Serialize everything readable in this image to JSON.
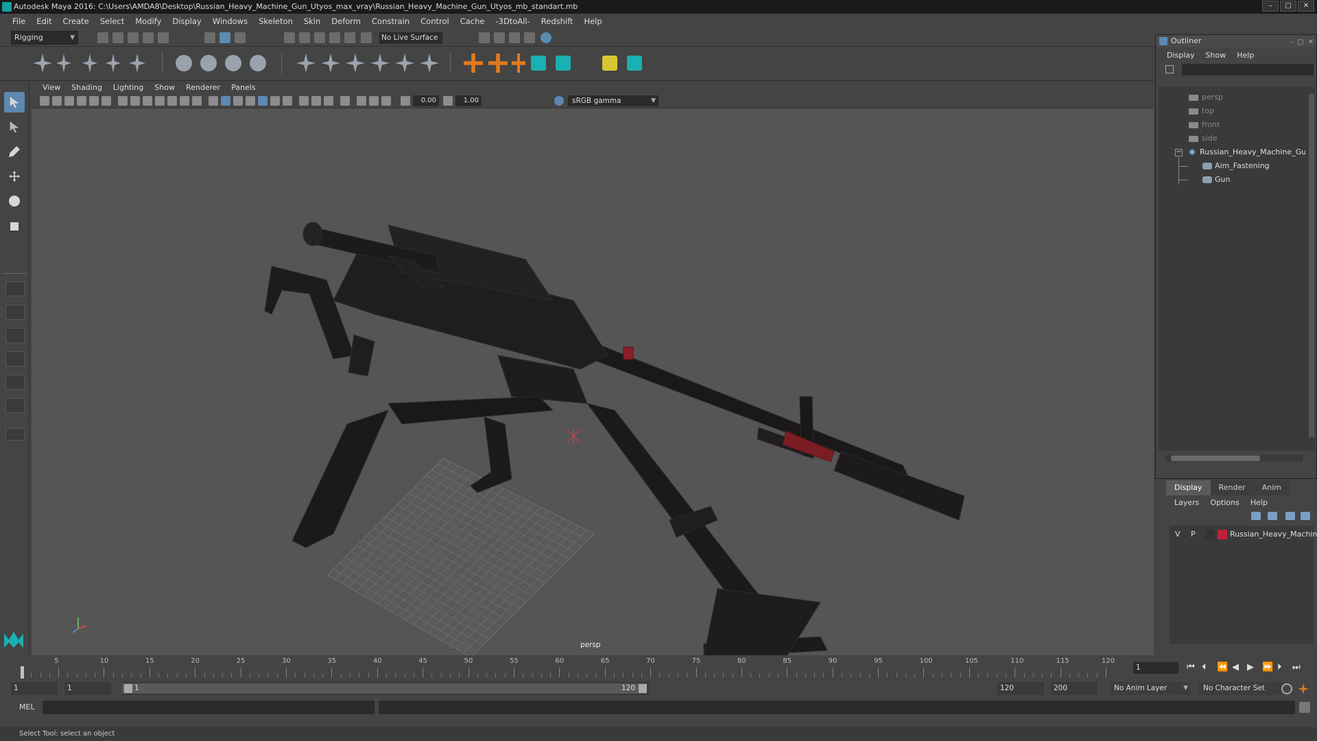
{
  "window": {
    "title": "Autodesk Maya 2016: C:\\Users\\AMDA8\\Desktop\\Russian_Heavy_Machine_Gun_Utyos_max_vray\\Russian_Heavy_Machine_Gun_Utyos_mb_standart.mb",
    "controls": [
      "–",
      "□",
      "✕"
    ]
  },
  "menubar": [
    "File",
    "Edit",
    "Create",
    "Select",
    "Modify",
    "Display",
    "Windows",
    "Skeleton",
    "Skin",
    "Deform",
    "Constrain",
    "Control",
    "Cache",
    "-3DtoAll-",
    "Redshift",
    "Help"
  ],
  "statusline": {
    "mode": "Rigging",
    "live_surface": "No Live Surface"
  },
  "viewport": {
    "menu": [
      "View",
      "Shading",
      "Lighting",
      "Show",
      "Renderer",
      "Panels"
    ],
    "exposure": "0.00",
    "gamma": "1.00",
    "color_management": "sRGB gamma",
    "camera_label": "persp",
    "manipulator_color": "#e23b3b"
  },
  "outliner": {
    "title": "Outliner",
    "menu": [
      "Display",
      "Show",
      "Help"
    ],
    "cameras": [
      "persp",
      "top",
      "front",
      "side"
    ],
    "root": "Russian_Heavy_Machine_Gun_Utyos",
    "children": [
      "Aim_Fastening",
      "Gun"
    ]
  },
  "layer_editor": {
    "tabs": [
      "Display",
      "Render",
      "Anim"
    ],
    "menu": [
      "Layers",
      "Options",
      "Help"
    ],
    "layer": {
      "visible": "V",
      "playback": "P",
      "name": "Russian_Heavy_Machine_Gun_Utyos",
      "color": "#c0213a"
    }
  },
  "timeline": {
    "ticks": [
      1,
      5,
      10,
      15,
      20,
      25,
      30,
      35,
      40,
      45,
      50,
      55,
      60,
      65,
      70,
      75,
      80,
      85,
      90,
      95,
      100,
      105,
      110,
      115,
      120
    ],
    "current_frame": "1",
    "current_frame_field": "1"
  },
  "range": {
    "start": "1",
    "playback_start": "1",
    "handle_start": "1",
    "handle_end": "120",
    "playback_end": "120",
    "end": "200",
    "anim_layer": "No Anim Layer",
    "character_set": "No Character Set"
  },
  "commandline": {
    "language": "MEL"
  },
  "helpline": {
    "text": "Select Tool: select an object"
  }
}
